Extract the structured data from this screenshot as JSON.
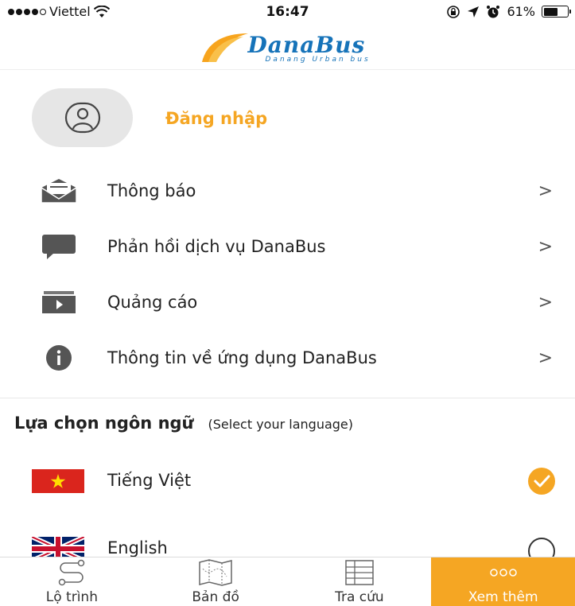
{
  "status_bar": {
    "carrier": "Viettel",
    "time": "16:47",
    "battery": "61%",
    "battery_level": 0.61
  },
  "header": {
    "logo_text": "DanaBus",
    "logo_subtitle": "Danang Urban bus"
  },
  "profile": {
    "login_label": "Đăng nhập"
  },
  "menu": {
    "items": [
      {
        "label": "Thông báo",
        "icon": "envelope-icon"
      },
      {
        "label": "Phản hồi dịch vụ DanaBus",
        "icon": "chat-bubble-icon"
      },
      {
        "label": "Quảng cáo",
        "icon": "video-play-icon"
      },
      {
        "label": "Thông tin về ứng dụng DanaBus",
        "icon": "info-icon"
      }
    ],
    "chevron": ">"
  },
  "language": {
    "title": "Lựa chọn ngôn ngữ",
    "subtitle": "(Select your language)",
    "options": [
      {
        "label": "Tiếng Việt",
        "flag": "vietnam-flag-icon",
        "selected": true
      },
      {
        "label": "English",
        "flag": "uk-flag-icon",
        "selected": false
      }
    ]
  },
  "tabs": [
    {
      "label": "Lộ trình",
      "icon": "route-icon",
      "active": false
    },
    {
      "label": "Bản đồ",
      "icon": "map-icon",
      "active": false
    },
    {
      "label": "Tra cứu",
      "icon": "table-icon",
      "active": false
    },
    {
      "label": "Xem thêm",
      "icon": "more-icon",
      "active": true
    }
  ],
  "colors": {
    "accent": "#f5a623",
    "logo_blue": "#1673b9"
  }
}
